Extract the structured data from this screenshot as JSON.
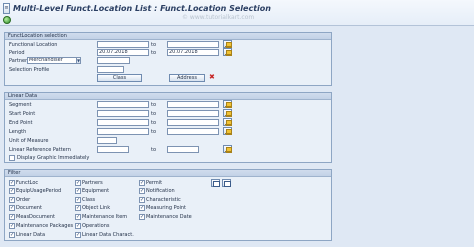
{
  "title": "Multi-Level Funct.Location List : Funct.Location Selection",
  "watermark": "© www.tutorialkart.com",
  "icons": {
    "title": "document-icon",
    "execute": "execute-icon",
    "multiple_selection": "multiple-selection-icon",
    "delete": "delete-icon",
    "select_all": "select-all-icon",
    "deselect_all": "deselect-all-icon"
  },
  "funcloc_selection": {
    "header": "FunctLocation selection",
    "to_label": "to",
    "functional_location": {
      "label": "Functional Location",
      "from": "",
      "to": ""
    },
    "period": {
      "label": "Period",
      "from": "20.07.2018",
      "to": "20.07.2018"
    },
    "partners": {
      "label": "Partners",
      "selected": "Merchandiser",
      "value": ""
    },
    "selection_profile": {
      "label": "Selection Profile",
      "value": ""
    },
    "class_button": "Class",
    "address_button": "Address"
  },
  "linear_data": {
    "header": "Linear Data",
    "to_label": "to",
    "segment": {
      "label": "Segment",
      "from": "",
      "to": ""
    },
    "start_point": {
      "label": "Start Point",
      "from": "",
      "to": ""
    },
    "end_point": {
      "label": "End Point",
      "from": "",
      "to": ""
    },
    "length": {
      "label": "Length",
      "from": "",
      "to": ""
    },
    "unit_of_measure": {
      "label": "Unit of Measure",
      "value": ""
    },
    "linear_reference_pattern": {
      "label": "Linear Reference Pattern",
      "from": "",
      "to": ""
    },
    "display_graphic": {
      "label": "Display Graphic Immediately",
      "checked": false
    }
  },
  "filter": {
    "header": "Filter",
    "col1": [
      {
        "label": "FunctLoc",
        "checked": true
      },
      {
        "label": "EquipUsagePeriod",
        "checked": true
      },
      {
        "label": "Order",
        "checked": true
      },
      {
        "label": "Document",
        "checked": true
      },
      {
        "label": "MeasDocument",
        "checked": true
      },
      {
        "label": "Maintenance Packages",
        "checked": true
      },
      {
        "label": "Linear Data",
        "checked": true
      }
    ],
    "col2": [
      {
        "label": "Partners",
        "checked": true
      },
      {
        "label": "Equipment",
        "checked": true
      },
      {
        "label": "Class",
        "checked": true
      },
      {
        "label": "Object Link",
        "checked": true
      },
      {
        "label": "Maintenance Item",
        "checked": true
      },
      {
        "label": "Operations",
        "checked": true
      },
      {
        "label": "Linear Data Charact.",
        "checked": true
      }
    ],
    "col3": [
      {
        "label": "Permit",
        "checked": true
      },
      {
        "label": "Notification",
        "checked": true
      },
      {
        "label": "Characteristic",
        "checked": true
      },
      {
        "label": "Measuring Point",
        "checked": true
      },
      {
        "label": "Maintenance Date",
        "checked": true
      }
    ]
  }
}
